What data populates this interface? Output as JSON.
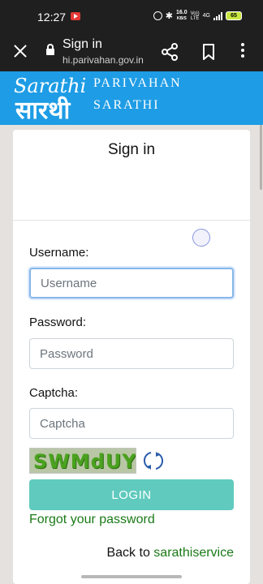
{
  "status_bar": {
    "time": "12:27",
    "net_speed": "16.0",
    "net_unit": "KB/S",
    "volte_top": "Vo))",
    "volte_bottom": "LTE",
    "network": "4G",
    "battery": "65"
  },
  "browser": {
    "title": "Sign in",
    "url": "hi.parivahan.gov.in",
    "icons": [
      "close-icon",
      "lock-icon",
      "share-icon",
      "bookmark-icon",
      "more-vert-icon"
    ]
  },
  "header": {
    "logo_text": "Sarathi",
    "logo_hindi": "सारथी",
    "line1": "PARIVAHAN",
    "line2": "SARATHI",
    "color": "#1e9ce5"
  },
  "form": {
    "title": "Sign in",
    "username_label": "Username:",
    "username_placeholder": "Username",
    "password_label": "Password:",
    "password_placeholder": "Password",
    "captcha_label": "Captcha:",
    "captcha_placeholder": "Captcha",
    "captcha_text": "SWMdUY",
    "login_label": "LOGIN",
    "forgot_label": "Forgot your password",
    "back_prefix": "Back to",
    "back_link": "sarathiservice",
    "login_color": "#5fcabd",
    "link_color": "#1a7a17"
  }
}
